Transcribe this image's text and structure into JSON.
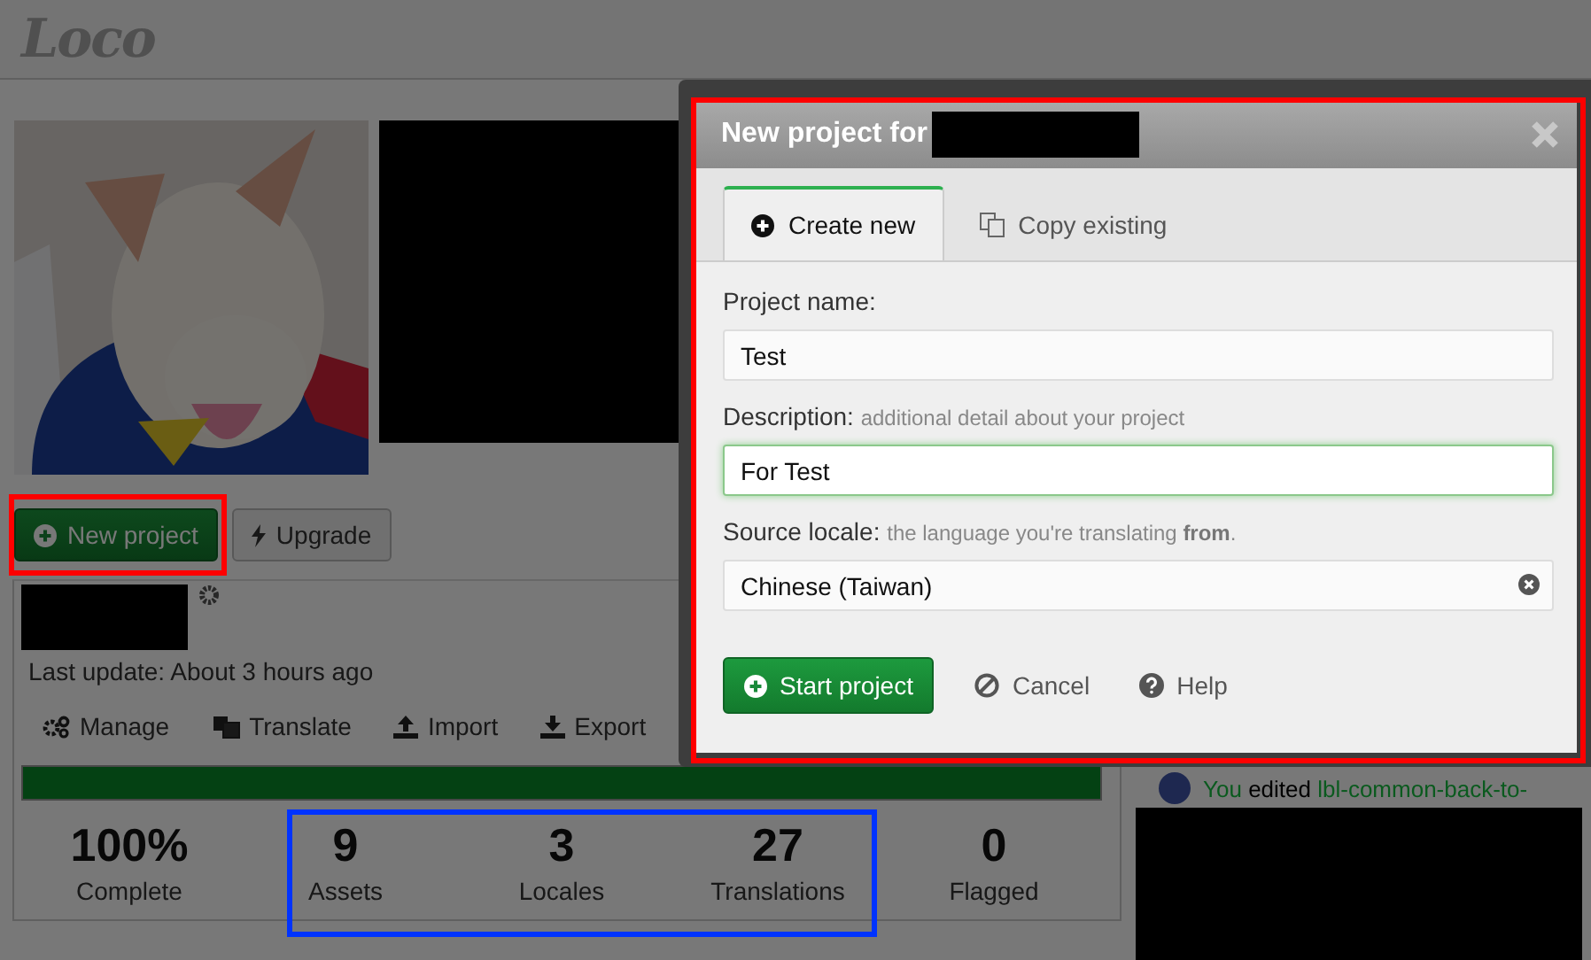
{
  "header": {
    "logo": "Loco"
  },
  "buttons": [
    {
      "label": "New project",
      "kind": "primary"
    },
    {
      "label": "Upgrade",
      "kind": "default"
    }
  ],
  "project": {
    "last_update": "Last update: About 3 hours ago",
    "actions": [
      {
        "label": "Manage"
      },
      {
        "label": "Translate"
      },
      {
        "label": "Import"
      },
      {
        "label": "Export"
      }
    ],
    "progress": {
      "level": 1.0
    },
    "stats": [
      {
        "value": "100%",
        "label": "Complete"
      },
      {
        "value": "9",
        "label": "Assets"
      },
      {
        "value": "3",
        "label": "Locales"
      },
      {
        "value": "27",
        "label": "Translations"
      },
      {
        "value": "0",
        "label": "Flagged"
      }
    ]
  },
  "activity": [
    {
      "actor": "You",
      "action": "edited",
      "target": "lbl-common-back-to-"
    }
  ],
  "dialog": {
    "title": "New project for",
    "tabs": [
      {
        "label": "Create new",
        "selected": true
      },
      {
        "label": "Copy existing",
        "selected": false
      }
    ],
    "fields": [
      {
        "label": "Project name:",
        "value": "Test",
        "focused": false
      },
      {
        "label": "Description:",
        "hint": "additional detail about your project",
        "value": "For Test",
        "focused": true
      },
      {
        "label": "Source locale:",
        "hint": "the language you're translating **from**.",
        "value": "Chinese (Taiwan)",
        "focused": false,
        "clearable": true
      }
    ],
    "actions": [
      {
        "label": "Start project",
        "kind": "primary"
      },
      {
        "label": "Cancel",
        "kind": "link"
      },
      {
        "label": "Help",
        "kind": "link"
      }
    ]
  }
}
